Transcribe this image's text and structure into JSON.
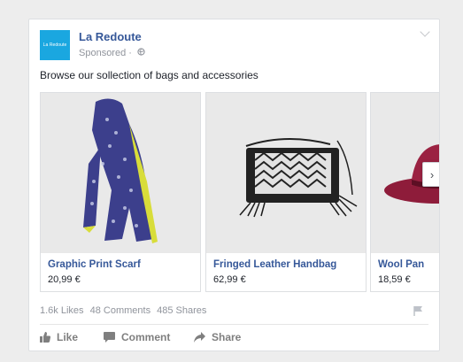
{
  "ad": {
    "page_name": "La Redoute",
    "logo_text": "La Redoute",
    "sponsored_label": "Sponsored",
    "sponsored_separator": "·",
    "caption": "Browse our sollection of bags and accessories",
    "accent_color": "#365899",
    "logo_color": "#1aa7e0"
  },
  "carousel": {
    "items": [
      {
        "title": "Graphic Print Scarf",
        "price": "20,99 €",
        "icon": "scarf-image"
      },
      {
        "title": "Fringed Leather Handbag",
        "price": "62,99 €",
        "icon": "handbag-image"
      },
      {
        "title": "Wool Pan",
        "price": "18,59 €",
        "icon": "hat-image"
      }
    ],
    "next_label": "›"
  },
  "stats": {
    "likes": "1.6k Likes",
    "comments": "48 Comments",
    "shares": "485 Shares"
  },
  "actions": {
    "like": "Like",
    "comment": "Comment",
    "share": "Share"
  }
}
